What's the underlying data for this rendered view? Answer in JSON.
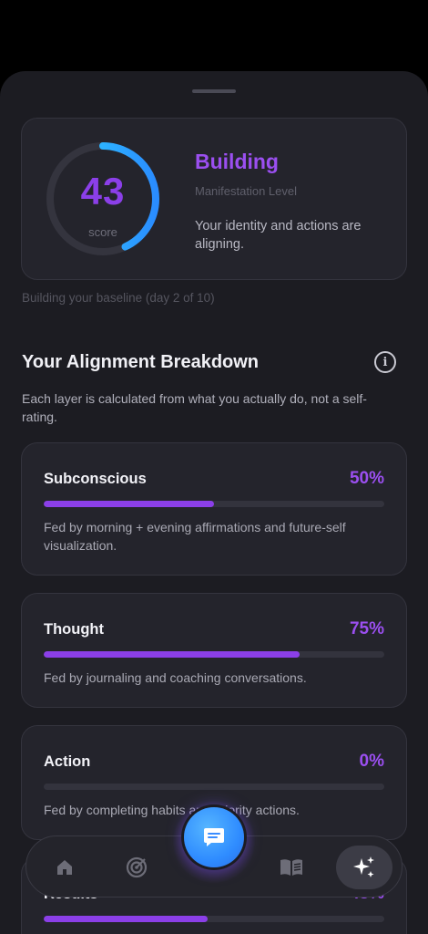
{
  "score": {
    "value": "43",
    "label": "score",
    "progress": 0.43,
    "level_title": "Building",
    "level_subtitle": "Manifestation Level",
    "description": "Your identity and actions are aligning."
  },
  "baseline_note": "Building your baseline (day 2 of 10)",
  "breakdown": {
    "title": "Your Alignment Breakdown",
    "description": "Each layer is calculated from what you actually do, not a self-rating.",
    "layers": [
      {
        "name": "Subconscious",
        "percent_label": "50%",
        "percent": 50,
        "description": "Fed by morning + evening affirmations and future-self visualization."
      },
      {
        "name": "Thought",
        "percent_label": "75%",
        "percent": 75,
        "description": "Fed by journaling and coaching conversations."
      },
      {
        "name": "Action",
        "percent_label": "0%",
        "percent": 0,
        "description": "Fed by completing habits and priority actions."
      },
      {
        "name": "Results",
        "percent_label": "48%",
        "percent": 48,
        "description": ""
      }
    ]
  },
  "nav": {
    "items": [
      {
        "icon": "home-icon"
      },
      {
        "icon": "target-icon"
      },
      {
        "icon": "chat-icon"
      },
      {
        "icon": "journal-icon"
      },
      {
        "icon": "sparkles-icon"
      }
    ],
    "active": "sparkles-icon"
  },
  "colors": {
    "accent": "#8b3fe8",
    "ring_start": "#2fd6ff",
    "ring_end": "#2a8cff",
    "background": "#1c1c22",
    "card": "#24242c"
  }
}
